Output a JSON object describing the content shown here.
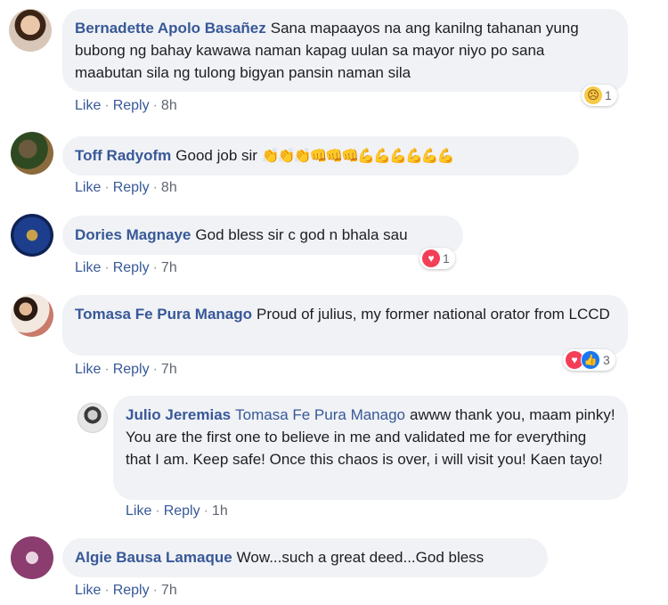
{
  "comments": [
    {
      "author": "Bernadette Apolo Basañez",
      "text": "Sana mapaayos na ang kanilng tahanan yung bubong ng bahay kawawa naman kapag uulan sa mayor niyo po sana maabutan sila ng tulong bigyan pansin naman sila",
      "like": "Like",
      "reply": "Reply",
      "time": "8h",
      "reaction_count": "1",
      "reaction_icons": [
        "sad-icon"
      ]
    },
    {
      "author": "Toff Radyofm",
      "text": "Good job sir",
      "emojis": "👏👏👏👊👊👊💪💪💪💪💪💪",
      "like": "Like",
      "reply": "Reply",
      "time": "8h"
    },
    {
      "author": "Dories Magnaye",
      "text": "God bless sir c god n bhala sau",
      "like": "Like",
      "reply": "Reply",
      "time": "7h",
      "reaction_count": "1",
      "reaction_icons": [
        "heart-icon"
      ]
    },
    {
      "author": "Tomasa Fe Pura Manago",
      "text": "Proud of julius, my former national orator from LCCD",
      "like": "Like",
      "reply": "Reply",
      "time": "7h",
      "reaction_count": "3",
      "reaction_icons": [
        "heart-icon",
        "like-icon"
      ]
    },
    {
      "author": "Julio Jeremias",
      "tagged": "Tomasa Fe Pura Manago",
      "text": "awww thank you, maam pinky! You are the first one to believe in me and validated me for everything that I am. Keep safe! Once this chaos is over, i will visit you! Kaen tayo!",
      "like": "Like",
      "reply": "Reply",
      "time": "1h"
    },
    {
      "author": "Algie Bausa Lamaque",
      "text": "Wow...such a great deed...God bless",
      "like": "Like",
      "reply": "Reply",
      "time": "7h"
    }
  ],
  "colors": {
    "link": "#385898",
    "bubble": "#f0f2f5",
    "text": "#1c1e21"
  }
}
